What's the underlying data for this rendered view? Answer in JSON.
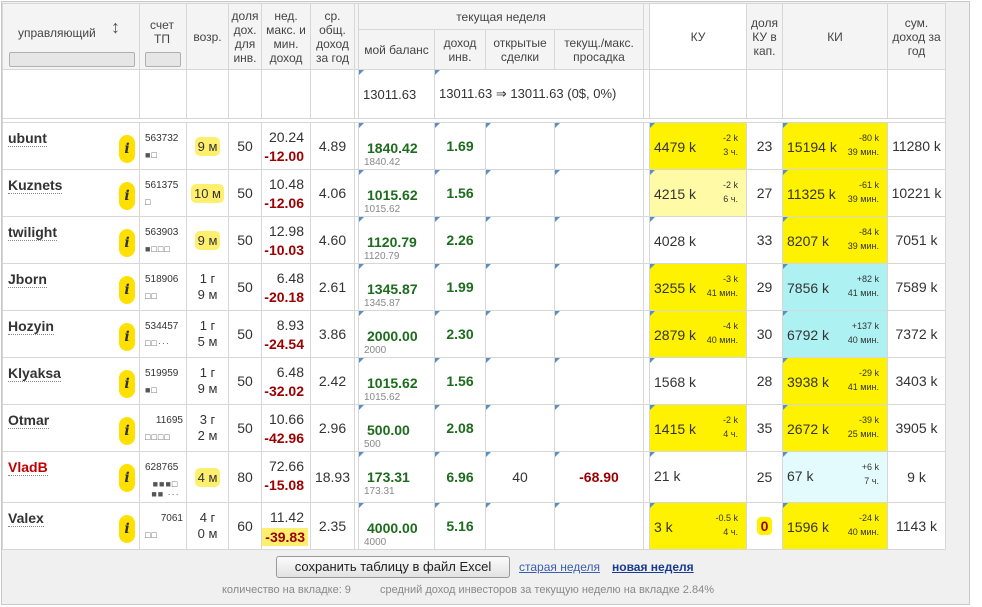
{
  "header": {
    "manager": "управляющий",
    "account": "счет ТП",
    "age": "возр.",
    "share_income": "доля дох. для инв.",
    "week_max_min": "нед. макс. и мин. доход",
    "avg_total": "ср. общ. доход за год",
    "current_week": "текущая неделя",
    "my_balance": "мой баланс",
    "investor_income": "доход инв.",
    "open_deals": "открытые сделки",
    "drawdown": "текущ./макс. просадка",
    "ku": "КУ",
    "ku_share": "доля КУ в кап.",
    "ki": "КИ",
    "sum_income": "сум. доход за год"
  },
  "summary": {
    "balance": "13011.63",
    "income_range": "13011.63 ⇒ 13011.63 (0$, 0%)"
  },
  "rows": [
    {
      "name": "ubunt",
      "acct": "563732",
      "dots": "■□",
      "age1": "9 м",
      "age2": "",
      "age_hl": true,
      "share": "50",
      "wmax": "20.24",
      "wmin": "-12.00",
      "avg": "4.89",
      "bal": "1840.42",
      "bal_sub": "1840.42",
      "inc": "1.69",
      "deals": "",
      "dd": "",
      "ku": "4479 k",
      "ku_d1": "-2 k",
      "ku_d2": "3 ч.",
      "ku_bg": "y",
      "kushare": "23",
      "ki": "15194 k",
      "ki_d1": "-80 k",
      "ki_d2": "39 мин.",
      "ki_bg": "y",
      "sum": "11280 k"
    },
    {
      "name": "Kuznets",
      "acct": "561375",
      "dots": "□",
      "age1": "10 м",
      "age2": "",
      "age_hl": true,
      "share": "50",
      "wmax": "10.48",
      "wmin": "-12.06",
      "avg": "4.06",
      "bal": "1015.62",
      "bal_sub": "1015.62",
      "inc": "1.56",
      "deals": "",
      "dd": "",
      "ku": "4215 k",
      "ku_d1": "-2 k",
      "ku_d2": "6 ч.",
      "ku_bg": "ly",
      "kushare": "27",
      "ki": "11325 k",
      "ki_d1": "-61 k",
      "ki_d2": "39 мин.",
      "ki_bg": "y",
      "sum": "10221 k"
    },
    {
      "name": "twilight",
      "acct": "563903",
      "dots": "■□□□",
      "age1": "9 м",
      "age2": "",
      "age_hl": true,
      "share": "50",
      "wmax": "12.98",
      "wmin": "-10.03",
      "avg": "4.60",
      "bal": "1120.79",
      "bal_sub": "1120.79",
      "inc": "2.26",
      "deals": "",
      "dd": "",
      "ku": "4028 k",
      "ku_d1": "",
      "ku_d2": "",
      "ku_bg": "",
      "kushare": "33",
      "ki": "8207 k",
      "ki_d1": "-84 k",
      "ki_d2": "39 мин.",
      "ki_bg": "y",
      "sum": "7051 k"
    },
    {
      "name": "Jborn",
      "acct": "518906",
      "dots": "□□",
      "age1": "1 г",
      "age2": "9 м",
      "age_hl": false,
      "share": "50",
      "wmax": "6.48",
      "wmin": "-20.18",
      "avg": "2.61",
      "bal": "1345.87",
      "bal_sub": "1345.87",
      "inc": "1.99",
      "deals": "",
      "dd": "",
      "ku": "3255 k",
      "ku_d1": "-3 k",
      "ku_d2": "41 мин.",
      "ku_bg": "y",
      "kushare": "29",
      "ki": "7856 k",
      "ki_d1": "+82 k",
      "ki_d2": "41 мин.",
      "ki_bg": "cy",
      "sum": "7589 k"
    },
    {
      "name": "Hozyin",
      "acct": "534457",
      "dots": "□□···",
      "age1": "1 г",
      "age2": "5 м",
      "age_hl": false,
      "share": "50",
      "wmax": "8.93",
      "wmin": "-24.54",
      "avg": "3.86",
      "bal": "2000.00",
      "bal_sub": "2000",
      "inc": "2.30",
      "deals": "",
      "dd": "",
      "ku": "2879 k",
      "ku_d1": "-4 k",
      "ku_d2": "40 мин.",
      "ku_bg": "y",
      "kushare": "30",
      "ki": "6792 k",
      "ki_d1": "+137 k",
      "ki_d2": "40 мин.",
      "ki_bg": "cy",
      "sum": "7372 k"
    },
    {
      "name": "Klyaksa",
      "acct": "519959",
      "dots": "■□",
      "age1": "1 г",
      "age2": "9 м",
      "age_hl": false,
      "share": "50",
      "wmax": "6.48",
      "wmin": "-32.02",
      "avg": "2.42",
      "bal": "1015.62",
      "bal_sub": "1015.62",
      "inc": "1.56",
      "deals": "",
      "dd": "",
      "ku": "1568 k",
      "ku_d1": "",
      "ku_d2": "",
      "ku_bg": "",
      "kushare": "28",
      "ki": "3938 k",
      "ki_d1": "-29 k",
      "ki_d2": "41 мин.",
      "ki_bg": "y",
      "sum": "3403 k"
    },
    {
      "name": "Otmar",
      "acct": "11695",
      "dots": "□□□□",
      "age1": "3 г",
      "age2": "2 м",
      "age_hl": false,
      "share": "50",
      "wmax": "10.66",
      "wmin": "-42.96",
      "avg": "2.96",
      "bal": "500.00",
      "bal_sub": "500",
      "inc": "2.08",
      "deals": "",
      "dd": "",
      "ku": "1415 k",
      "ku_d1": "-2 k",
      "ku_d2": "4 ч.",
      "ku_bg": "y",
      "kushare": "35",
      "ki": "2672 k",
      "ki_d1": "-39 k",
      "ki_d2": "25 мин.",
      "ki_bg": "y",
      "sum": "3905 k"
    },
    {
      "name": "VladB",
      "acct": "628765",
      "dots": "■■■□ ■■ ···",
      "age1": "4 м",
      "age2": "",
      "age_hl": true,
      "share": "80",
      "wmax": "72.66",
      "wmin": "-15.08",
      "avg": "18.93",
      "bal": "173.31",
      "bal_sub": "173.31",
      "inc": "6.96",
      "deals": "40",
      "dd": "-68.90",
      "ku": "21 k",
      "ku_d1": "",
      "ku_d2": "",
      "ku_bg": "",
      "kushare": "25",
      "ki": "67 k",
      "ki_d1": "+6 k",
      "ki_d2": "7 ч.",
      "ki_bg": "lc",
      "sum": "9 k"
    },
    {
      "name": "Valex",
      "acct": "7061",
      "dots": "□□",
      "age1": "4 г",
      "age2": "0 м",
      "age_hl": false,
      "share": "60",
      "wmax": "11.42",
      "wmin": "-39.83",
      "avg": "2.35",
      "bal": "4000.00",
      "bal_sub": "4000",
      "inc": "5.16",
      "deals": "",
      "dd": "",
      "ku": "3 k",
      "ku_d1": "-0.5 k",
      "ku_d2": "4 ч.",
      "ku_bg": "y",
      "kushare": "0",
      "ki": "1596 k",
      "ki_d1": "-24 k",
      "ki_d2": "40 мин.",
      "ki_bg": "y",
      "sum": "1143 k"
    }
  ],
  "footer": {
    "save_button": "сохранить таблицу в файл Excel",
    "old_week": "старая неделя",
    "new_week": "новая неделя",
    "count_text": "количество на вкладке: 9",
    "avg_text": "средний доход инвесторов за текущую неделю на вкладке 2.84%"
  },
  "colors": {
    "yellow": "#fff200",
    "light_yellow": "#fffaa5",
    "cyan": "#aef1f3",
    "light_cyan": "#e3fbfc",
    "dark_red": "#9b0000",
    "green": "#1d6b1d"
  }
}
